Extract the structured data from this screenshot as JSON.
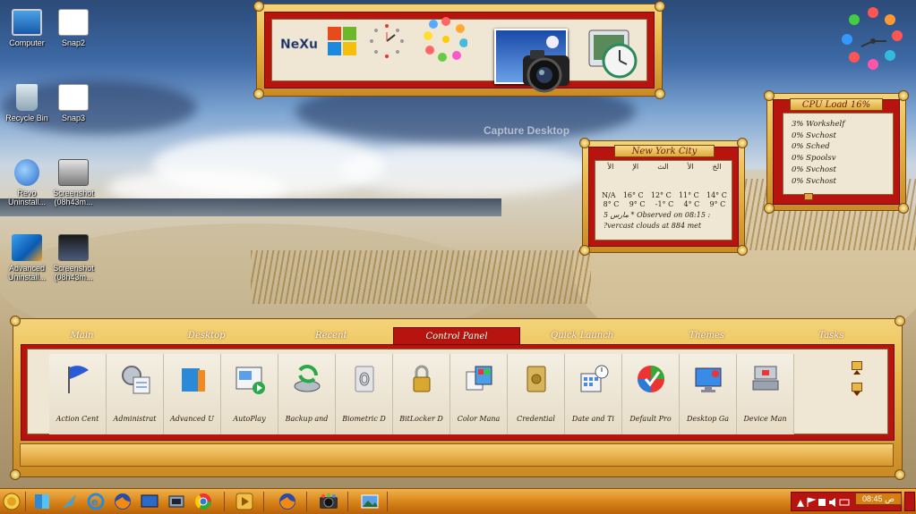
{
  "desktop": {
    "icons": [
      {
        "label": "Computer",
        "icon": "computer-icon"
      },
      {
        "label": "Snap2",
        "icon": "image-file-icon"
      },
      {
        "label": "Recycle Bin",
        "icon": "recycle-bin-icon"
      },
      {
        "label": "Snap3",
        "icon": "image-file-icon"
      },
      {
        "label": "Revo Uninstall...",
        "icon": "revo-uninstaller-icon"
      },
      {
        "label": "Screenshot (08h43m...",
        "icon": "image-file-icon"
      },
      {
        "label": "Advanced Uninstall...",
        "icon": "advanced-uninstaller-icon"
      },
      {
        "label": "Screenshot (08h43m...",
        "icon": "image-file-icon"
      }
    ],
    "watermark": "Capture Desktop"
  },
  "dock": {
    "items": [
      "nexus-icon",
      "windows-logo-icon",
      "clock-gadget-icon",
      "flower-icon",
      "desktop-picture-icon",
      "camera-icon",
      "system-clock-icon"
    ]
  },
  "weather": {
    "title": "New York City",
    "days": [
      "الأ",
      "الإ",
      "الث",
      "الأ",
      "الخ"
    ],
    "highs": [
      "N/A",
      "16° C",
      "12° C",
      "11° C",
      "14° C"
    ],
    "lows": [
      "8° C",
      "9° C",
      "-1° C",
      "4° C",
      "9° C"
    ],
    "observed": "5 مارس * Observed on 08:15 :",
    "condition": "?vercast clouds at 884 met"
  },
  "cpu": {
    "title": "CPU Load 16%",
    "processes": [
      "3% Workshelf",
      "0% Svchost",
      "0% Sched",
      "0% Spoolsv",
      "0% Svchost",
      "0% Svchost"
    ]
  },
  "launcher": {
    "tabs": [
      "Main",
      "Desktop",
      "Recent",
      "Control Panel",
      "Quick Launch",
      "Themes",
      "Tasks"
    ],
    "active_tab": "Control Panel",
    "tiles": [
      {
        "label": "Action Cent",
        "icon": "action-center-flag-icon"
      },
      {
        "label": "Administrat",
        "icon": "administrative-tools-icon"
      },
      {
        "label": "Advanced U",
        "icon": "advanced-user-icon"
      },
      {
        "label": "AutoPlay",
        "icon": "autoplay-icon"
      },
      {
        "label": "Backup and",
        "icon": "backup-restore-icon"
      },
      {
        "label": "Biometric D",
        "icon": "fingerprint-icon"
      },
      {
        "label": "BitLocker D",
        "icon": "bitlocker-lock-icon"
      },
      {
        "label": "Color Mana",
        "icon": "color-management-icon"
      },
      {
        "label": "Credential",
        "icon": "credential-vault-icon"
      },
      {
        "label": "Date and Ti",
        "icon": "date-time-icon"
      },
      {
        "label": "Default Pro",
        "icon": "default-programs-icon"
      },
      {
        "label": "Desktop Ga",
        "icon": "desktop-gadgets-icon"
      },
      {
        "label": "Device Man",
        "icon": "device-manager-icon"
      }
    ]
  },
  "taskbar": {
    "pinned": [
      "start-orb-icon",
      "windows-explorer-icon",
      "quill-icon",
      "internet-explorer-icon",
      "firefox-icon",
      "show-desktop-icon",
      "media-center-icon",
      "chrome-icon",
      "media-player-icon",
      "firefox-window-icon",
      "camera-app-icon",
      "pictures-app-icon"
    ],
    "clock": "08:45 ص"
  }
}
